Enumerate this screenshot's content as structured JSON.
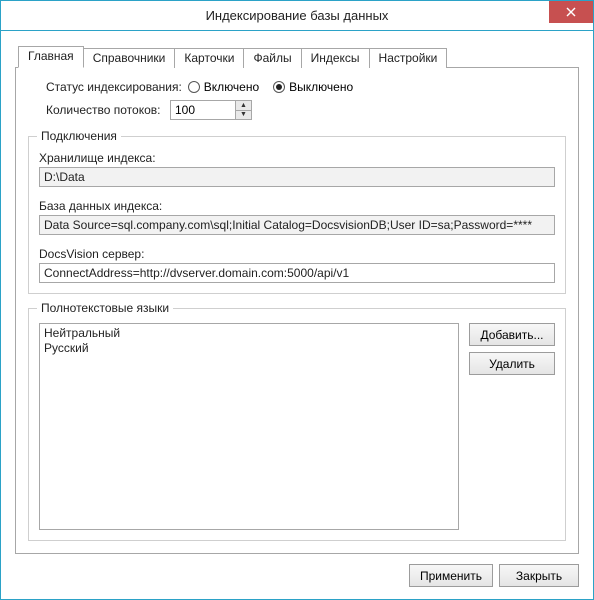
{
  "window": {
    "title": "Индексирование базы данных"
  },
  "tabs": [
    {
      "label": "Главная",
      "active": true
    },
    {
      "label": "Справочники"
    },
    {
      "label": "Карточки"
    },
    {
      "label": "Файлы"
    },
    {
      "label": "Индексы"
    },
    {
      "label": "Настройки"
    }
  ],
  "status": {
    "label": "Статус индексирования:",
    "options": [
      {
        "label": "Включено",
        "selected": false
      },
      {
        "label": "Выключено",
        "selected": true
      }
    ]
  },
  "threads": {
    "label": "Количество потоков:",
    "value": "100"
  },
  "groups": {
    "connections": {
      "legend": "Подключения",
      "storage_label": "Хранилище индекса:",
      "storage_value": "D:\\Data",
      "db_label": "База данных индекса:",
      "db_value": "Data Source=sql.company.com\\sql;Initial Catalog=DocsvisionDB;User ID=sa;Password=****",
      "server_label": "DocsVision сервер:",
      "server_value": "ConnectAddress=http://dvserver.domain.com:5000/api/v1"
    },
    "languages": {
      "legend": "Полнотекстовые языки",
      "items": [
        "Нейтральный",
        "Русский"
      ],
      "add_label": "Добавить...",
      "remove_label": "Удалить"
    }
  },
  "footer": {
    "apply": "Применить",
    "close": "Закрыть"
  }
}
